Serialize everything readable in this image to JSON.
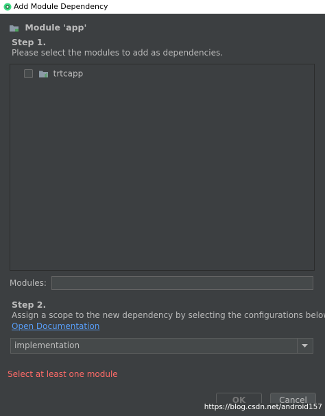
{
  "window": {
    "title": "Add Module Dependency"
  },
  "module_header": "Module 'app'",
  "step1": {
    "title": "Step 1.",
    "description": "Please select the modules to add as dependencies."
  },
  "modules_list": {
    "items": [
      {
        "label": "trtcapp",
        "checked": false,
        "icon": "module-folder-icon"
      }
    ]
  },
  "modules_field": {
    "label": "Modules:",
    "value": ""
  },
  "step2": {
    "title": "Step 2.",
    "description": "Assign a scope to the new dependency by selecting the configurations below.",
    "doc_link": "Open Documentation"
  },
  "scope": {
    "selected": "implementation"
  },
  "error_message": "Select at least one module",
  "buttons": {
    "ok": "OK",
    "cancel": "Cancel"
  },
  "watermark": "https://blog.csdn.net/android157",
  "colors": {
    "background": "#3c3f41",
    "link": "#589df6",
    "error": "#ff6b68"
  }
}
